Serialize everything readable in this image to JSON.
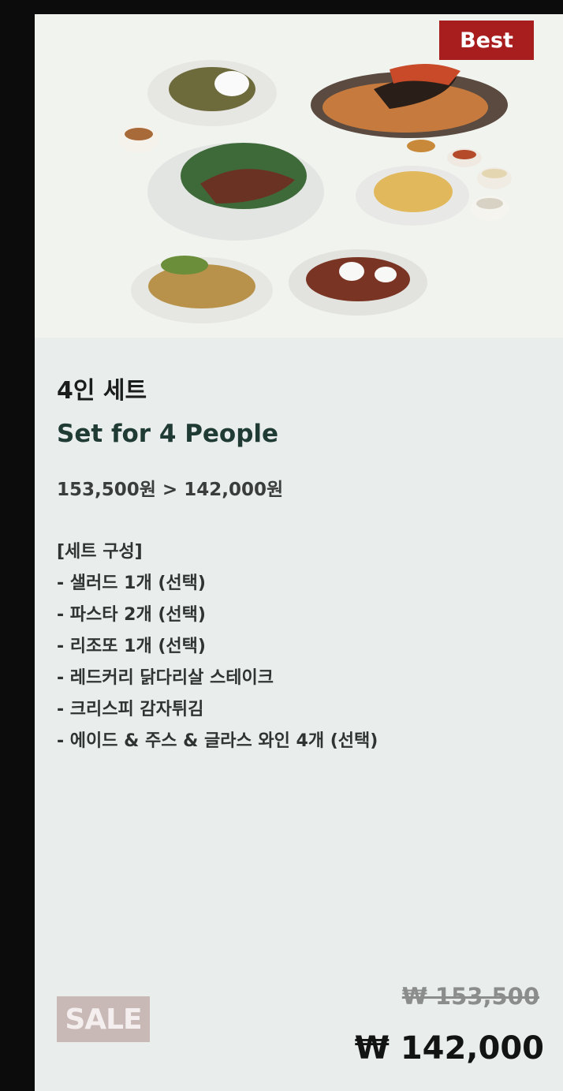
{
  "badge": {
    "best": "Best",
    "sale": "SALE"
  },
  "product": {
    "title_ko": "4인 세트",
    "title_en": "Set for 4 People",
    "price_line": "153,500원 > 142,000원"
  },
  "composition": {
    "header": "[세트 구성]",
    "items": [
      "- 샐러드 1개 (선택)",
      "- 파스타 2개 (선택)",
      "- 리조또 1개 (선택)",
      "- 레드커리 닭다리살 스테이크",
      "- 크리스피 감자튀김",
      "- 에이드 & 주스 & 글라스 와인 4개 (선택)"
    ]
  },
  "price": {
    "original": "₩ 153,500",
    "sale": "₩ 142,000"
  },
  "colors": {
    "best_badge": "#a81e1e",
    "sale_badge": "#c8b9b6",
    "title_en": "#1f3b34",
    "card_bg": "#e9eeec"
  }
}
